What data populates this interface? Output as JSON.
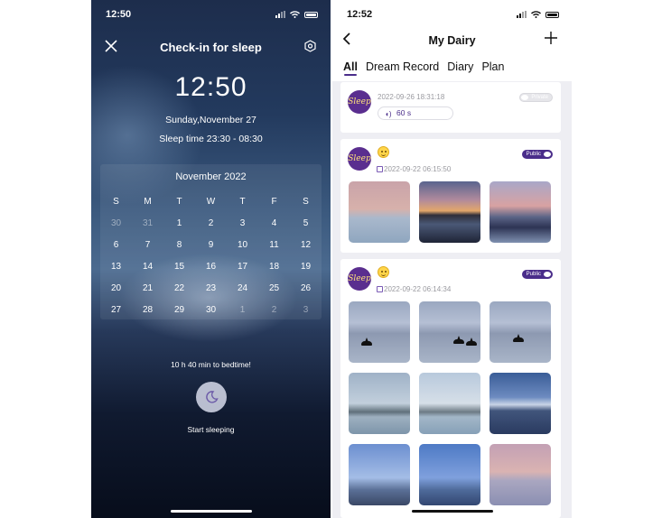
{
  "left": {
    "status": {
      "time": "12:50"
    },
    "title": "Check-in for sleep",
    "clock": "12:50",
    "date": "Sunday,November 27",
    "sleep_time": "Sleep time 23:30 - 08:30",
    "calendar": {
      "month": "November 2022",
      "weekdays": [
        "S",
        "M",
        "T",
        "W",
        "T",
        "F",
        "S"
      ],
      "days": [
        {
          "d": "30",
          "dim": true
        },
        {
          "d": "31",
          "dim": true
        },
        {
          "d": "1"
        },
        {
          "d": "2"
        },
        {
          "d": "3"
        },
        {
          "d": "4"
        },
        {
          "d": "5"
        },
        {
          "d": "6"
        },
        {
          "d": "7"
        },
        {
          "d": "8"
        },
        {
          "d": "9"
        },
        {
          "d": "10"
        },
        {
          "d": "11"
        },
        {
          "d": "12"
        },
        {
          "d": "13"
        },
        {
          "d": "14"
        },
        {
          "d": "15"
        },
        {
          "d": "16"
        },
        {
          "d": "17"
        },
        {
          "d": "18"
        },
        {
          "d": "19"
        },
        {
          "d": "20"
        },
        {
          "d": "21"
        },
        {
          "d": "22"
        },
        {
          "d": "23"
        },
        {
          "d": "24"
        },
        {
          "d": "25"
        },
        {
          "d": "26"
        },
        {
          "d": "27"
        },
        {
          "d": "28"
        },
        {
          "d": "29"
        },
        {
          "d": "30"
        },
        {
          "d": "1",
          "dim": true
        },
        {
          "d": "2",
          "dim": true
        },
        {
          "d": "3",
          "dim": true
        }
      ]
    },
    "bedtime_note": "10 h 40 min to bedtime!",
    "start_label": "Start sleeping",
    "icons": {
      "close": "close-icon",
      "settings": "settings-icon",
      "moon": "moon-icon"
    }
  },
  "right": {
    "status": {
      "time": "12:52"
    },
    "title": "My Dairy",
    "tabs": [
      "All",
      "Dream Record",
      "Diary",
      "Plan"
    ],
    "active_tab": "All",
    "accent": "#4a2d8a",
    "entries": [
      {
        "avatar_text": "Sleep",
        "timestamp": "2022-09-26 18:31:18",
        "badge": "Private",
        "audio_duration": "60 s",
        "photos": []
      },
      {
        "avatar_text": "Sleep",
        "timestamp": "2022-09-22 06:15:50",
        "badge": "Public",
        "photos": [
          "sunset over sea",
          "sunset over bay",
          "sunset over hills"
        ]
      },
      {
        "avatar_text": "Sleep",
        "timestamp": "2022-09-22 06:14:34",
        "badge": "Public",
        "photos": [
          "orca near hills",
          "two orcas",
          "orca in sea",
          "lighthouse island",
          "lighthouse island",
          "snowy mountain",
          "rocks in sea",
          "rocks in sea",
          "pink sky over sea"
        ]
      }
    ]
  }
}
